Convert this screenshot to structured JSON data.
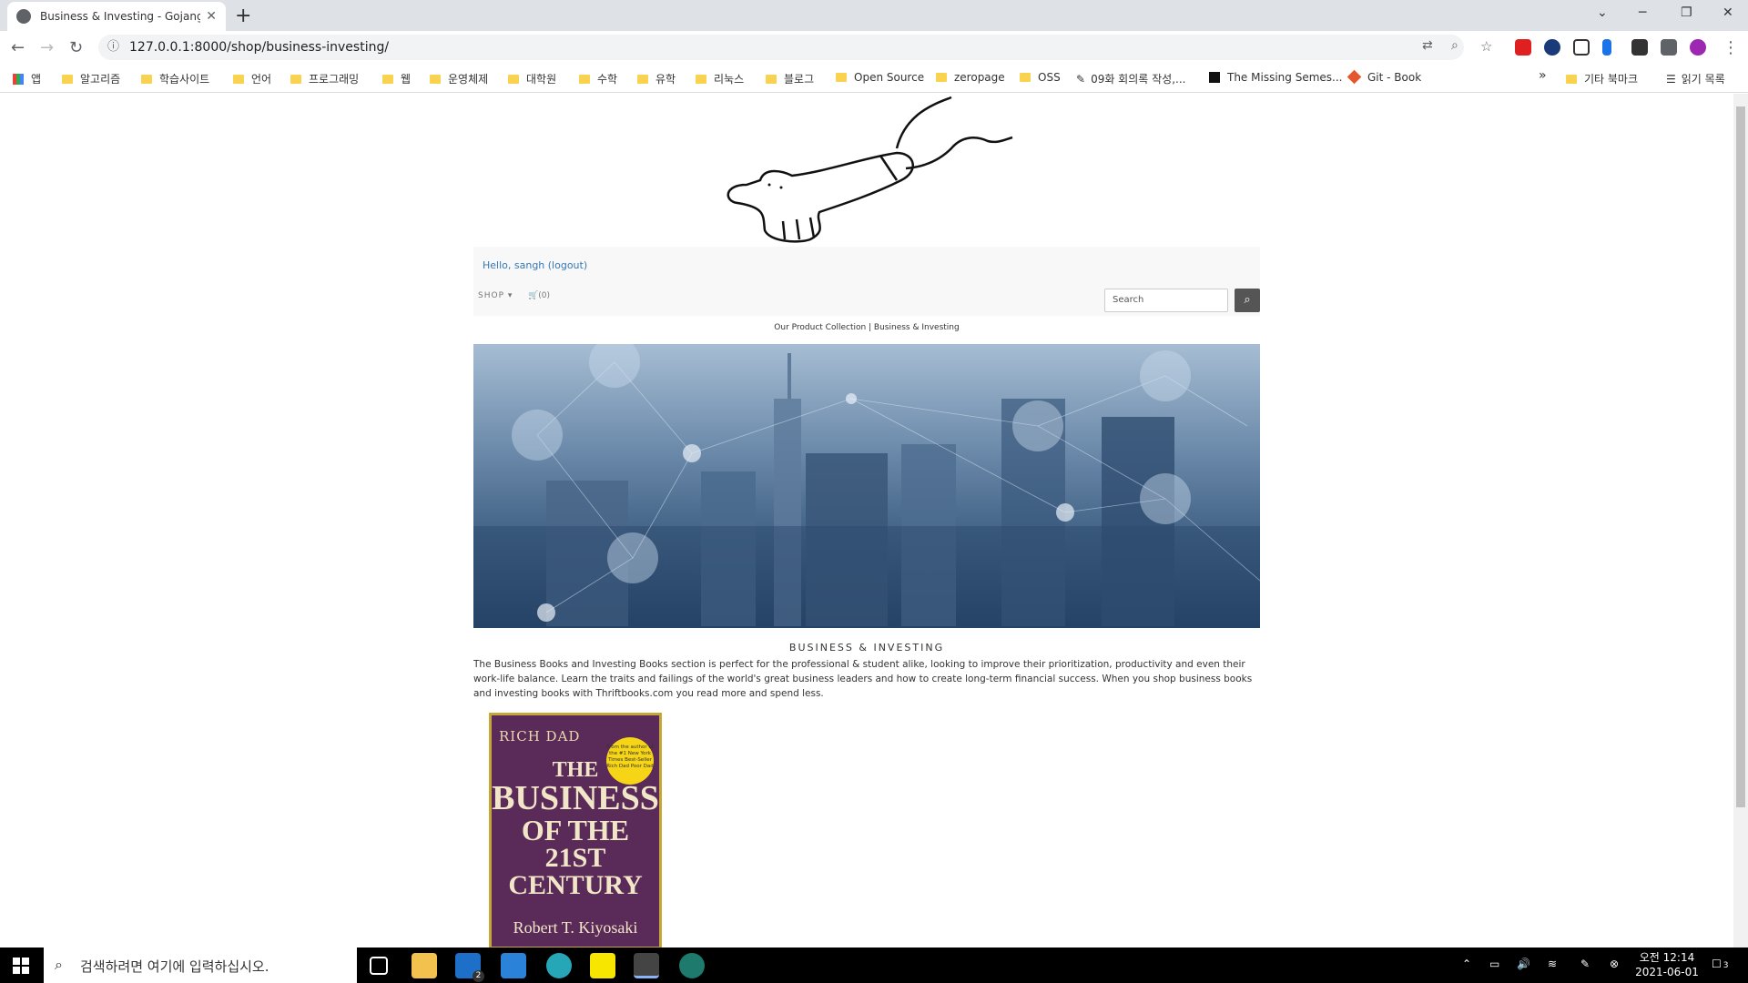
{
  "browser": {
    "tab_title": "Business & Investing - Gojangn",
    "url": "127.0.0.1:8000/shop/business-investing/",
    "bookmarks": [
      "앱",
      "알고리즘",
      "학습사이트",
      "언어",
      "프로그래밍",
      "웹",
      "운영체제",
      "대학원",
      "수학",
      "유학",
      "리눅스",
      "블로그",
      "Open Source",
      "zeropage",
      "OSS",
      "09화 회의록 작성,...",
      "The Missing Semes...",
      "Git - Book"
    ],
    "more_bookmarks": "기타 북마크",
    "reading_list": "읽기 목록",
    "overflow": "»"
  },
  "page": {
    "greeting": "Hello, sangh (logout)",
    "shop_label": "SHOP",
    "cart_label": "(0)",
    "search_placeholder": "Search",
    "breadcrumb": "Our Product Collection | Business & Investing",
    "category_heading": "BUSINESS & INVESTING",
    "category_description": "The Business Books and Investing Books section is perfect for the professional & student alike, looking to improve their prioritization, productivity and even their work-life balance. Learn the traits and failings of the world's great business leaders and how to create long-term financial success. When you shop business books and investing books with Thriftbooks.com you read more and spend less.",
    "book": {
      "series": "RICH DAD",
      "title_line1": "THE",
      "title_line2": "BUSINESS",
      "title_line3": "OF THE",
      "title_line4": "21ST CENTURY",
      "author": "Robert T. Kiyosaki",
      "badge": "From the author of the #1 New York Times Best-Seller Rich Dad Poor Dad"
    }
  },
  "taskbar": {
    "search_placeholder": "검색하려면 여기에 입력하십시오.",
    "time": "오전 12:14",
    "date": "2021-06-01",
    "notification_count": "3",
    "mail_badge": "2"
  },
  "colors": {
    "link": "#337ab7",
    "tabbar": "#dee1e6",
    "book_cover": "#5a2a58",
    "book_gold": "#c8a537"
  }
}
